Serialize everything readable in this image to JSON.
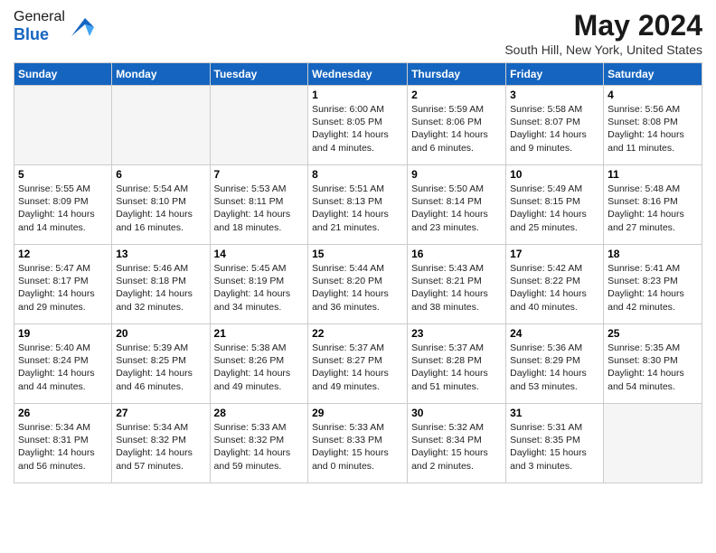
{
  "header": {
    "logo_line1": "General",
    "logo_line2": "Blue",
    "month_title": "May 2024",
    "subtitle": "South Hill, New York, United States"
  },
  "weekdays": [
    "Sunday",
    "Monday",
    "Tuesday",
    "Wednesday",
    "Thursday",
    "Friday",
    "Saturday"
  ],
  "weeks": [
    [
      {
        "day": "",
        "info": ""
      },
      {
        "day": "",
        "info": ""
      },
      {
        "day": "",
        "info": ""
      },
      {
        "day": "1",
        "info": "Sunrise: 6:00 AM\nSunset: 8:05 PM\nDaylight: 14 hours\nand 4 minutes."
      },
      {
        "day": "2",
        "info": "Sunrise: 5:59 AM\nSunset: 8:06 PM\nDaylight: 14 hours\nand 6 minutes."
      },
      {
        "day": "3",
        "info": "Sunrise: 5:58 AM\nSunset: 8:07 PM\nDaylight: 14 hours\nand 9 minutes."
      },
      {
        "day": "4",
        "info": "Sunrise: 5:56 AM\nSunset: 8:08 PM\nDaylight: 14 hours\nand 11 minutes."
      }
    ],
    [
      {
        "day": "5",
        "info": "Sunrise: 5:55 AM\nSunset: 8:09 PM\nDaylight: 14 hours\nand 14 minutes."
      },
      {
        "day": "6",
        "info": "Sunrise: 5:54 AM\nSunset: 8:10 PM\nDaylight: 14 hours\nand 16 minutes."
      },
      {
        "day": "7",
        "info": "Sunrise: 5:53 AM\nSunset: 8:11 PM\nDaylight: 14 hours\nand 18 minutes."
      },
      {
        "day": "8",
        "info": "Sunrise: 5:51 AM\nSunset: 8:13 PM\nDaylight: 14 hours\nand 21 minutes."
      },
      {
        "day": "9",
        "info": "Sunrise: 5:50 AM\nSunset: 8:14 PM\nDaylight: 14 hours\nand 23 minutes."
      },
      {
        "day": "10",
        "info": "Sunrise: 5:49 AM\nSunset: 8:15 PM\nDaylight: 14 hours\nand 25 minutes."
      },
      {
        "day": "11",
        "info": "Sunrise: 5:48 AM\nSunset: 8:16 PM\nDaylight: 14 hours\nand 27 minutes."
      }
    ],
    [
      {
        "day": "12",
        "info": "Sunrise: 5:47 AM\nSunset: 8:17 PM\nDaylight: 14 hours\nand 29 minutes."
      },
      {
        "day": "13",
        "info": "Sunrise: 5:46 AM\nSunset: 8:18 PM\nDaylight: 14 hours\nand 32 minutes."
      },
      {
        "day": "14",
        "info": "Sunrise: 5:45 AM\nSunset: 8:19 PM\nDaylight: 14 hours\nand 34 minutes."
      },
      {
        "day": "15",
        "info": "Sunrise: 5:44 AM\nSunset: 8:20 PM\nDaylight: 14 hours\nand 36 minutes."
      },
      {
        "day": "16",
        "info": "Sunrise: 5:43 AM\nSunset: 8:21 PM\nDaylight: 14 hours\nand 38 minutes."
      },
      {
        "day": "17",
        "info": "Sunrise: 5:42 AM\nSunset: 8:22 PM\nDaylight: 14 hours\nand 40 minutes."
      },
      {
        "day": "18",
        "info": "Sunrise: 5:41 AM\nSunset: 8:23 PM\nDaylight: 14 hours\nand 42 minutes."
      }
    ],
    [
      {
        "day": "19",
        "info": "Sunrise: 5:40 AM\nSunset: 8:24 PM\nDaylight: 14 hours\nand 44 minutes."
      },
      {
        "day": "20",
        "info": "Sunrise: 5:39 AM\nSunset: 8:25 PM\nDaylight: 14 hours\nand 46 minutes."
      },
      {
        "day": "21",
        "info": "Sunrise: 5:38 AM\nSunset: 8:26 PM\nDaylight: 14 hours\nand 49 minutes."
      },
      {
        "day": "22",
        "info": "Sunrise: 5:37 AM\nSunset: 8:27 PM\nDaylight: 14 hours\nand 49 minutes."
      },
      {
        "day": "23",
        "info": "Sunrise: 5:37 AM\nSunset: 8:28 PM\nDaylight: 14 hours\nand 51 minutes."
      },
      {
        "day": "24",
        "info": "Sunrise: 5:36 AM\nSunset: 8:29 PM\nDaylight: 14 hours\nand 53 minutes."
      },
      {
        "day": "25",
        "info": "Sunrise: 5:35 AM\nSunset: 8:30 PM\nDaylight: 14 hours\nand 54 minutes."
      }
    ],
    [
      {
        "day": "26",
        "info": "Sunrise: 5:34 AM\nSunset: 8:31 PM\nDaylight: 14 hours\nand 56 minutes."
      },
      {
        "day": "27",
        "info": "Sunrise: 5:34 AM\nSunset: 8:32 PM\nDaylight: 14 hours\nand 57 minutes."
      },
      {
        "day": "28",
        "info": "Sunrise: 5:33 AM\nSunset: 8:32 PM\nDaylight: 14 hours\nand 59 minutes."
      },
      {
        "day": "29",
        "info": "Sunrise: 5:33 AM\nSunset: 8:33 PM\nDaylight: 15 hours\nand 0 minutes."
      },
      {
        "day": "30",
        "info": "Sunrise: 5:32 AM\nSunset: 8:34 PM\nDaylight: 15 hours\nand 2 minutes."
      },
      {
        "day": "31",
        "info": "Sunrise: 5:31 AM\nSunset: 8:35 PM\nDaylight: 15 hours\nand 3 minutes."
      },
      {
        "day": "",
        "info": ""
      }
    ]
  ]
}
